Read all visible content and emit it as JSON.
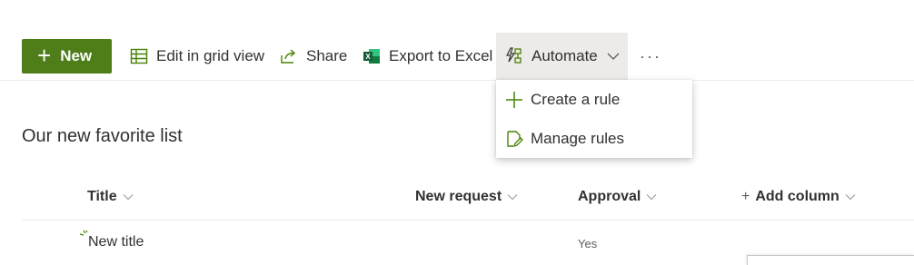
{
  "toolbar": {
    "new_label": "New",
    "edit_grid_label": "Edit in grid view",
    "share_label": "Share",
    "export_label": "Export to Excel",
    "automate_label": "Automate",
    "more_label": "···"
  },
  "automate_menu": {
    "items": [
      {
        "label": "Create a rule",
        "icon": "plus-icon"
      },
      {
        "label": "Manage rules",
        "icon": "edit-rules-icon"
      }
    ]
  },
  "list": {
    "title": "Our new favorite list",
    "columns": [
      "Title",
      "New request",
      "Approval",
      "Add column"
    ],
    "rows": [
      {
        "title": "New title",
        "new_request": "",
        "approval": "Yes"
      }
    ]
  },
  "colors": {
    "accent_green": "#4e7d1a",
    "icon_green": "#498205",
    "excel_green": "#217346",
    "menu_hover": "#edebe9"
  }
}
